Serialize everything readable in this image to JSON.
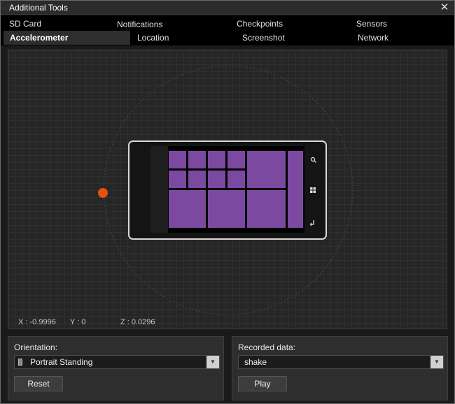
{
  "window": {
    "title": "Additional Tools",
    "close_glyph": "✕"
  },
  "tabs": [
    {
      "label": "SD Card"
    },
    {
      "label": "Notifications"
    },
    {
      "label": "Checkpoints"
    },
    {
      "label": "Sensors"
    },
    {
      "label": "Accelerometer"
    },
    {
      "label": "Location"
    },
    {
      "label": "Screenshot"
    },
    {
      "label": "Network"
    }
  ],
  "active_tab": "Accelerometer",
  "readout": {
    "x": "X : -0.9996",
    "y": "Y : 0",
    "z": "Z : 0.0296"
  },
  "orientation": {
    "label": "Orientation:",
    "value": "Portrait Standing",
    "reset_label": "Reset"
  },
  "recorded": {
    "label": "Recorded data:",
    "value": "shake",
    "play_label": "Play"
  },
  "icons": {
    "phone_hardware_buttons": [
      "search-icon",
      "windows-start-icon",
      "back-icon"
    ],
    "dropdown": "chevron-down-icon",
    "close": "close-icon"
  },
  "colors": {
    "tile": "#7b4aa0",
    "handle": "#e8500e",
    "background": "#1a1a1a",
    "stage": "#262626"
  }
}
